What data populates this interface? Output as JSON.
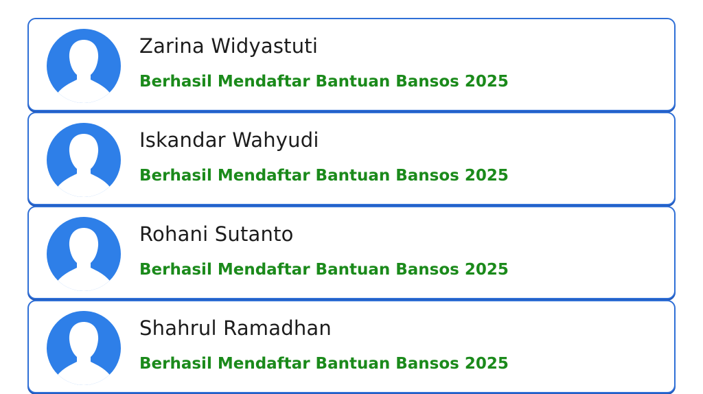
{
  "colors": {
    "border": "#2f6fd6",
    "avatar": "#2e7fe8",
    "status": "#1b8a1b",
    "name": "#1c1c1c"
  },
  "entries": [
    {
      "name": "Zarina Widyastuti",
      "status": "Berhasil Mendaftar Bantuan Bansos 2025",
      "icon": "person-silhouette-icon"
    },
    {
      "name": "Iskandar Wahyudi",
      "status": "Berhasil Mendaftar Bantuan Bansos 2025",
      "icon": "person-silhouette-icon"
    },
    {
      "name": "Rohani Sutanto",
      "status": "Berhasil Mendaftar Bantuan Bansos 2025",
      "icon": "person-silhouette-icon"
    },
    {
      "name": "Shahrul Ramadhan",
      "status": "Berhasil Mendaftar Bantuan Bansos 2025",
      "icon": "person-silhouette-icon"
    }
  ]
}
